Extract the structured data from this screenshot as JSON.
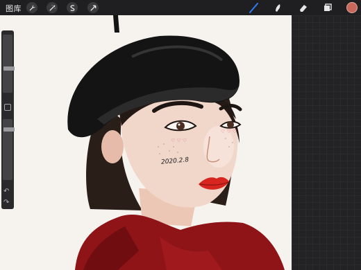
{
  "topbar": {
    "gallery_label": "图库",
    "tools_left": [
      "wrench-icon",
      "magic-wand-icon",
      "selection-icon",
      "transform-arrow-icon"
    ],
    "tools_right": [
      "brush-icon",
      "smudge-icon",
      "eraser-icon",
      "layers-icon"
    ],
    "current_color": "#c8685a",
    "accent_color": "#2f7df6"
  },
  "sidebar": {
    "brush_size_label": "",
    "opacity_label": "",
    "undo_icon": "undo-icon",
    "redo_icon": "redo-icon"
  },
  "canvas": {
    "artwork_text": "2020.2.8"
  }
}
